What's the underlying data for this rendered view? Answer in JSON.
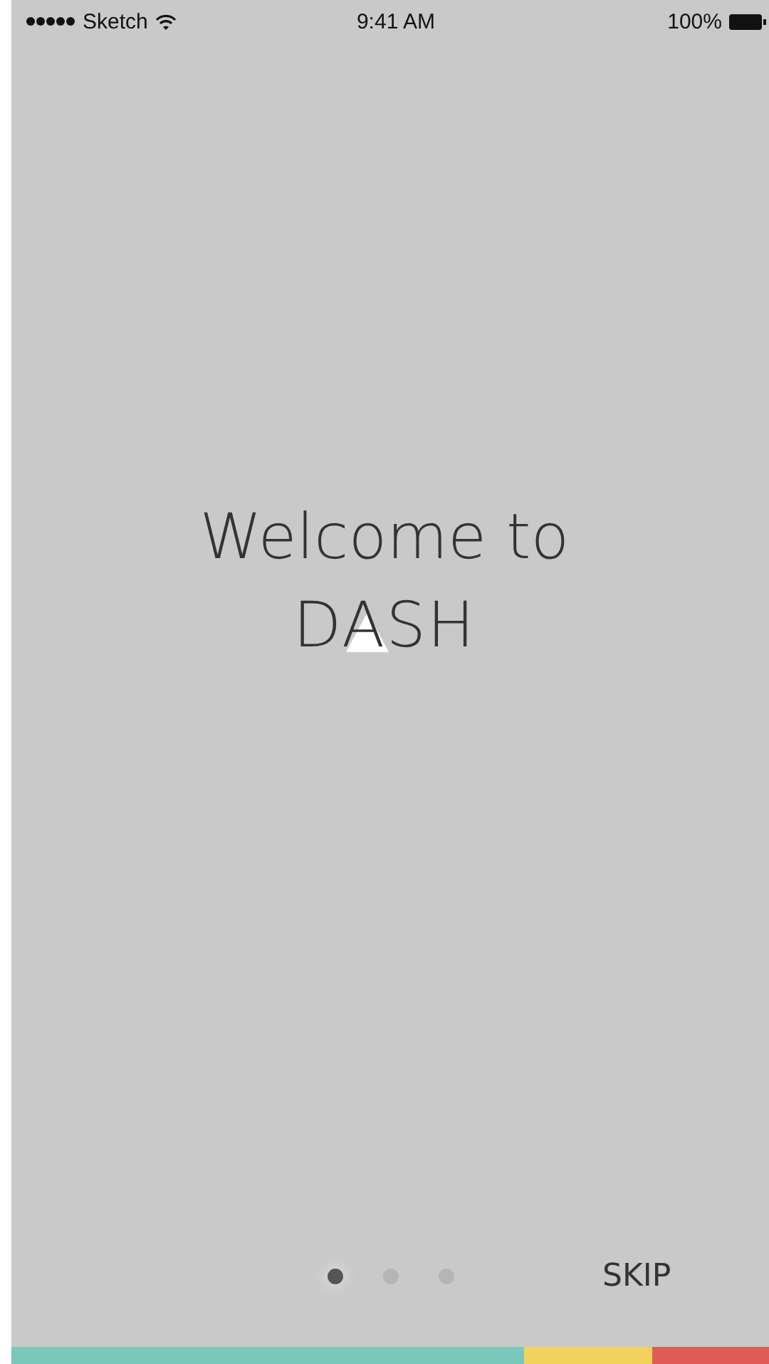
{
  "status_bar": {
    "carrier": "Sketch",
    "time": "9:41 AM",
    "battery": "100%"
  },
  "welcome": {
    "title": "Welcome to",
    "logo": "DASH"
  },
  "pager": [
    {
      "selected": true
    },
    {
      "selected": false
    },
    {
      "selected": false
    }
  ],
  "skip_button": "SKIP",
  "color_bar": [
    {
      "color": "#78c8bc"
    },
    {
      "color": "#f3d25c"
    },
    {
      "color": "#df5b56"
    }
  ]
}
